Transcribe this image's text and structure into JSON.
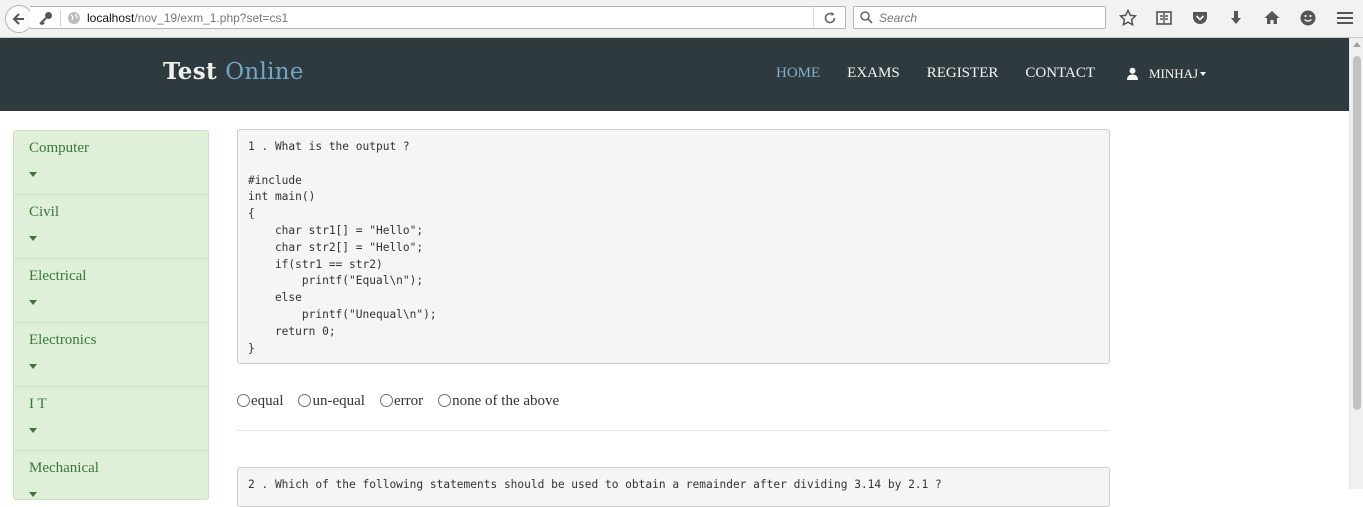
{
  "browser": {
    "url_host": "localhost",
    "url_path": "/nov_19/exm_1.php?set=cs1",
    "search_placeholder": "Search",
    "icons": [
      "back-arrow-icon",
      "key-icon",
      "globe-icon",
      "reload-icon",
      "search-icon",
      "star-icon",
      "reading-list-icon",
      "pocket-icon",
      "download-icon",
      "home-icon",
      "smiley-icon",
      "hamburger-menu-icon"
    ]
  },
  "navbar": {
    "brand_first": "Test",
    "brand_second": "Online",
    "links": [
      "HOME",
      "EXAMS",
      "REGISTER",
      "CONTACT"
    ],
    "active_link": "HOME",
    "user_name": "MINHAJ"
  },
  "sidebar": {
    "items": [
      {
        "label": "Computer"
      },
      {
        "label": "Civil"
      },
      {
        "label": "Electrical"
      },
      {
        "label": "Electronics"
      },
      {
        "label": "I T"
      },
      {
        "label": "Mechanical"
      }
    ]
  },
  "questions": [
    {
      "code": "1 . What is the output ?\n\n#include\nint main()\n{\n    char str1[] = \"Hello\";\n    char str2[] = \"Hello\";\n    if(str1 == str2)\n        printf(\"Equal\\n\");\n    else\n        printf(\"Unequal\\n\");\n    return 0;\n}",
      "options": [
        "equal",
        "un-equal",
        "error",
        "none of the above"
      ]
    },
    {
      "code": "2 . Which of the following statements should be used to obtain a remainder after dividing 3.14 by 2.1 ?"
    }
  ],
  "colors": {
    "navbar_bg": "#2f3a3e",
    "brand_accent": "#6fa6c6",
    "active_link": "#7fb0cf",
    "sidebar_bg": "#dff0d8",
    "sidebar_text": "#3c763d"
  }
}
